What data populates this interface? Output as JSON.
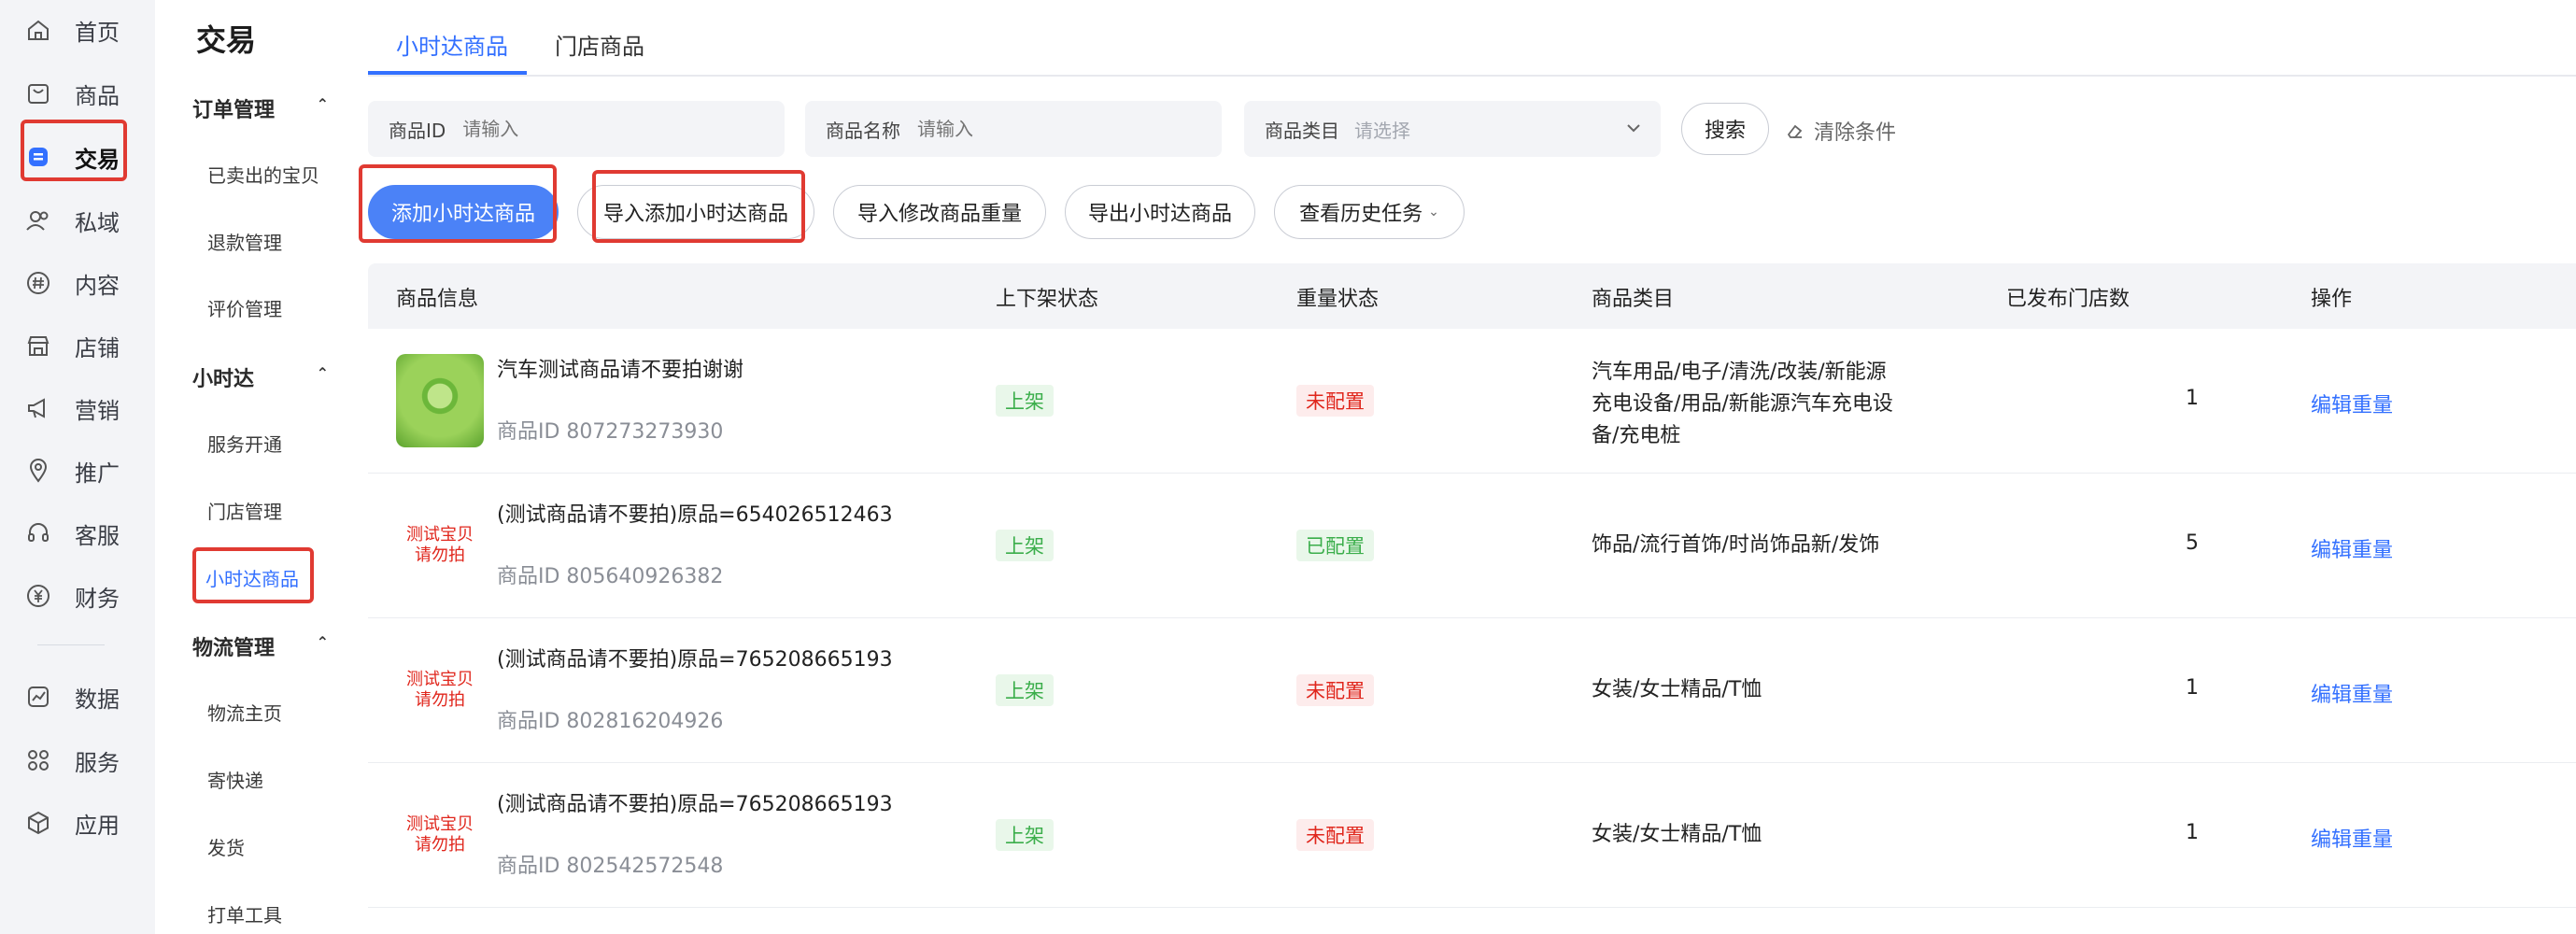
{
  "rail": {
    "items": [
      {
        "label": "首页",
        "icon": "home-icon"
      },
      {
        "label": "商品",
        "icon": "bag-icon"
      },
      {
        "label": "交易",
        "icon": "trade-icon"
      },
      {
        "label": "私域",
        "icon": "users-icon"
      },
      {
        "label": "内容",
        "icon": "hash-icon"
      },
      {
        "label": "店铺",
        "icon": "store-icon"
      },
      {
        "label": "营销",
        "icon": "megaphone-icon"
      },
      {
        "label": "推广",
        "icon": "pin-icon"
      },
      {
        "label": "客服",
        "icon": "headset-icon"
      },
      {
        "label": "财务",
        "icon": "yen-icon"
      },
      {
        "label": "数据",
        "icon": "chart-icon"
      },
      {
        "label": "服务",
        "icon": "grid-icon"
      },
      {
        "label": "应用",
        "icon": "cube-icon"
      }
    ],
    "active": "交易"
  },
  "submenu": {
    "title": "交易",
    "groups": [
      {
        "label": "订单管理",
        "items": [
          "已卖出的宝贝",
          "退款管理",
          "评价管理"
        ]
      },
      {
        "label": "小时达",
        "items": [
          "服务开通",
          "门店管理",
          "小时达商品"
        ]
      },
      {
        "label": "物流管理",
        "items": [
          "物流主页",
          "寄快递",
          "发货",
          "打单工具"
        ]
      }
    ],
    "active_item": "小时达商品"
  },
  "tabs": [
    "小时达商品",
    "门店商品"
  ],
  "filters": {
    "product_id": {
      "label": "商品ID",
      "placeholder": "请输入"
    },
    "product_name": {
      "label": "商品名称",
      "placeholder": "请输入"
    },
    "category": {
      "label": "商品类目",
      "placeholder": "请选择"
    },
    "search_label": "搜索",
    "clear_label": "清除条件"
  },
  "actions": [
    "添加小时达商品",
    "导入添加小时达商品",
    "导入修改商品重量",
    "导出小时达商品",
    "查看历史任务"
  ],
  "table": {
    "headers": [
      "商品信息",
      "上下架状态",
      "重量状态",
      "商品类目",
      "已发布门店数",
      "操作"
    ],
    "rows": [
      {
        "name": "汽车测试商品请不要拍谢谢",
        "id": "商品ID  807273273930",
        "status": "上架",
        "weight": "未配置",
        "category": "汽车用品/电子/清洗/改装/新能源充电设备/用品/新能源汽车充电设备/充电桩",
        "stores": "1",
        "op": "编辑重量",
        "thumb": "green"
      },
      {
        "name": "(测试商品请不要拍)原品=654026512463",
        "id": "商品ID  805640926382",
        "status": "上架",
        "weight": "已配置",
        "category": "饰品/流行首饰/时尚饰品新/发饰",
        "stores": "5",
        "op": "编辑重量",
        "thumb": "text"
      },
      {
        "name": "(测试商品请不要拍)原品=765208665193",
        "id": "商品ID  802816204926",
        "status": "上架",
        "weight": "未配置",
        "category": "女装/女士精品/T恤",
        "stores": "1",
        "op": "编辑重量",
        "thumb": "text"
      },
      {
        "name": "(测试商品请不要拍)原品=765208665193",
        "id": "商品ID  802542572548",
        "status": "上架",
        "weight": "未配置",
        "category": "女装/女士精品/T恤",
        "stores": "1",
        "op": "编辑重量",
        "thumb": "text"
      }
    ],
    "thumb_text": [
      "测试宝贝",
      "请勿拍"
    ]
  },
  "colors": {
    "accent": "#3370ff",
    "primary_button": "#4b82f7",
    "highlight": "#e03a32",
    "ok": "#3bae4b",
    "warn": "#e0261c"
  }
}
